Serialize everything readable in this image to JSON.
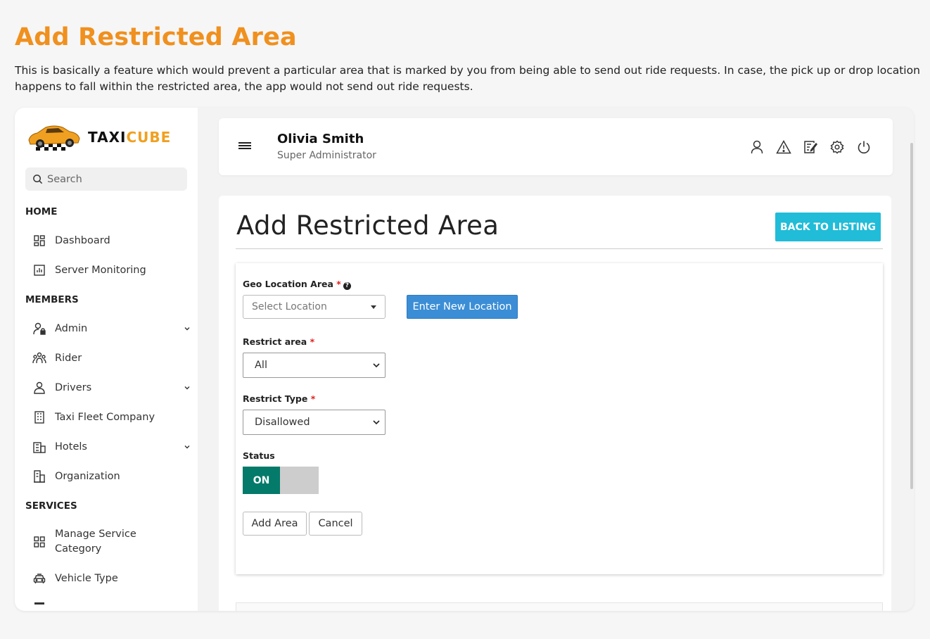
{
  "page": {
    "heading": "Add Restricted Area",
    "description": "This is basically a feature which would prevent a particular area that is marked by you from being able to send out ride requests. In case, the pick up or drop location happens to fall within the restricted area, the app would not send out ride requests."
  },
  "brand": {
    "name_part1": "TAXI",
    "name_part2": "CUBE",
    "accent": "#f0a020"
  },
  "search": {
    "placeholder": "Search"
  },
  "sidebar": {
    "sections": [
      {
        "title": "HOME",
        "items": [
          {
            "label": "Dashboard",
            "icon": "dashboard-icon"
          },
          {
            "label": "Server Monitoring",
            "icon": "chart-icon"
          }
        ]
      },
      {
        "title": "MEMBERS",
        "items": [
          {
            "label": "Admin",
            "icon": "admin-icon"
          },
          {
            "label": "Rider",
            "icon": "rider-icon"
          },
          {
            "label": "Drivers",
            "icon": "driver-icon"
          },
          {
            "label": "Taxi Fleet Company",
            "icon": "building-icon"
          },
          {
            "label": "Hotels",
            "icon": "hotel-icon"
          },
          {
            "label": "Organization",
            "icon": "organization-icon"
          }
        ]
      },
      {
        "title": "SERVICES",
        "items": [
          {
            "label": "Manage Service Category",
            "icon": "category-icon"
          },
          {
            "label": "Vehicle Type",
            "icon": "car-icon"
          }
        ]
      }
    ]
  },
  "user": {
    "name": "Olivia Smith",
    "role": "Super Administrator"
  },
  "topbar_icons": [
    "user-icon",
    "warning-icon",
    "notes-icon",
    "settings-icon",
    "power-icon"
  ],
  "card": {
    "title": "Add Restricted Area",
    "back_label": "BACK TO LISTING",
    "back_color": "#20bcd8"
  },
  "form": {
    "geo_label": "Geo Location Area",
    "geo_placeholder": "Select Location",
    "new_location_label": "Enter New Location",
    "restrict_area_label": "Restrict area",
    "restrict_area_value": "All",
    "restrict_type_label": "Restrict Type",
    "restrict_type_value": "Disallowed",
    "status_label": "Status",
    "status_value": "ON",
    "required_mark": "*",
    "add_label": "Add Area",
    "cancel_label": "Cancel"
  },
  "colors": {
    "heading": "#f0901e",
    "toggle_on": "#047a6a",
    "primary_button": "#3b8ed6"
  }
}
